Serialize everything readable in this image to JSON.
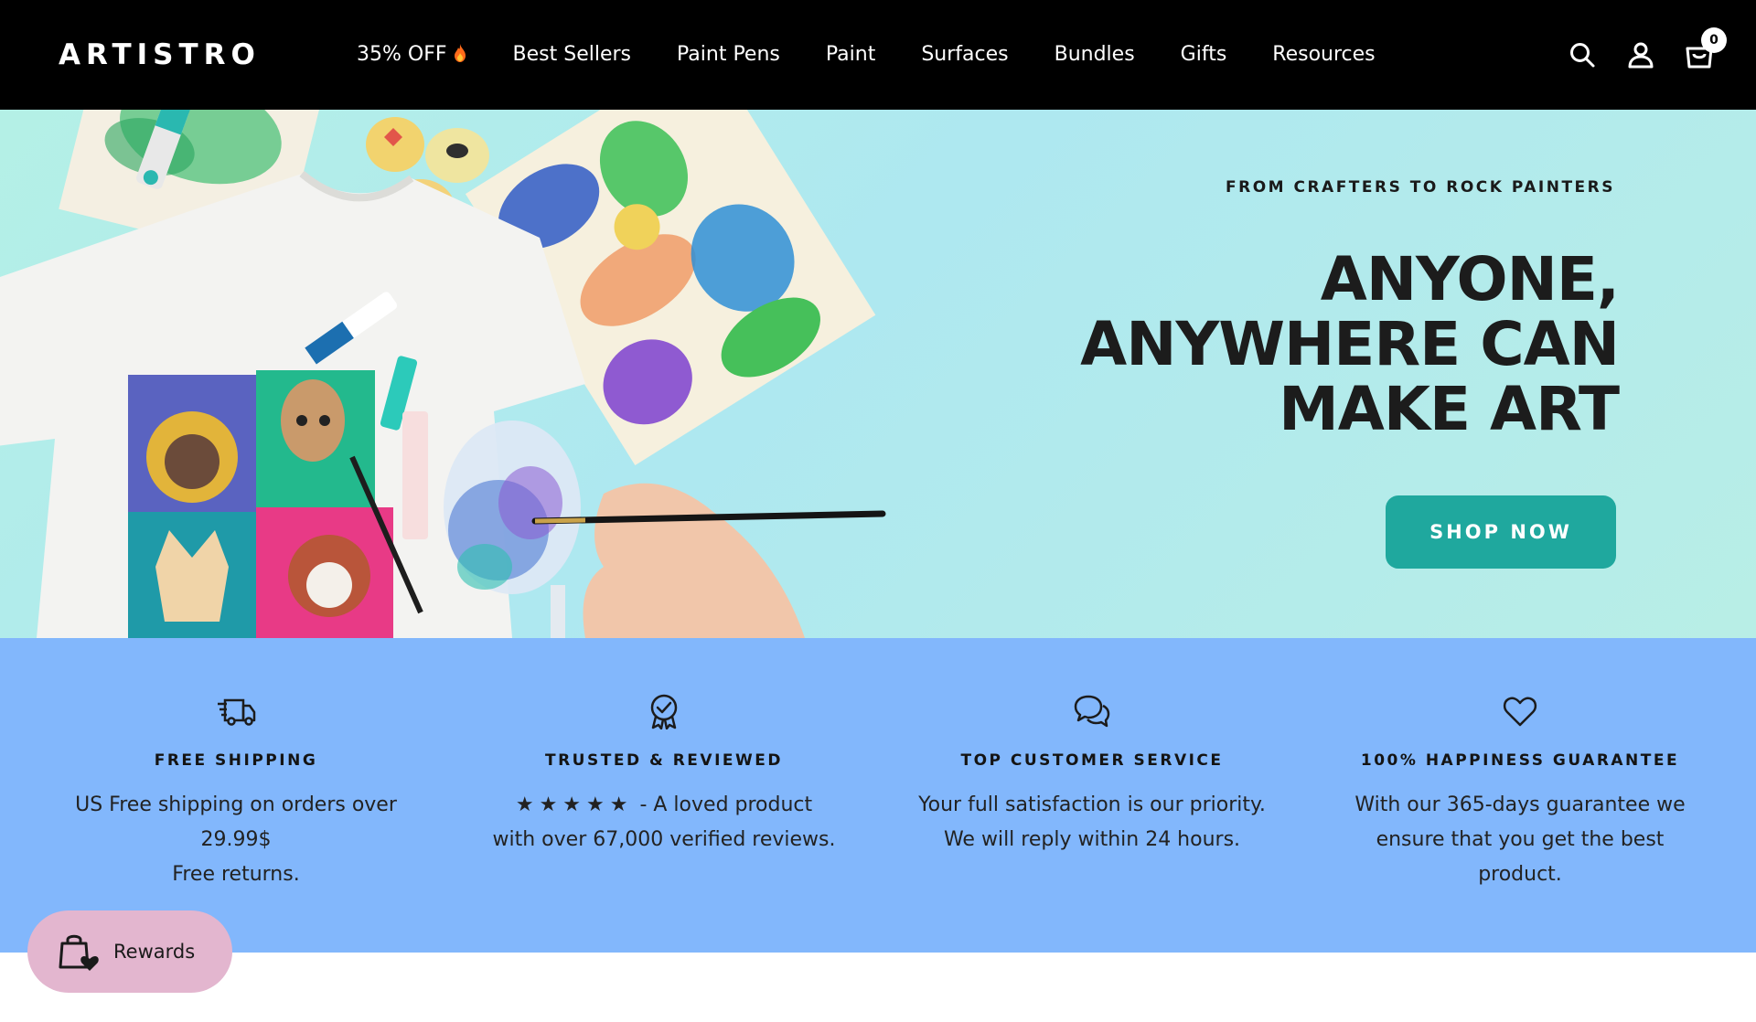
{
  "header": {
    "logo": "ARTISTRO",
    "nav": [
      {
        "label": "35% OFF",
        "icon": "flame-icon"
      },
      {
        "label": "Best Sellers"
      },
      {
        "label": "Paint Pens"
      },
      {
        "label": "Paint"
      },
      {
        "label": "Surfaces"
      },
      {
        "label": "Bundles"
      },
      {
        "label": "Gifts"
      },
      {
        "label": "Resources"
      }
    ],
    "icons": [
      "search-icon",
      "account-icon",
      "cart-icon"
    ],
    "cart_count": "0"
  },
  "hero": {
    "eyebrow": "FROM CRAFTERS TO ROCK PAINTERS",
    "title_lines": [
      "ANYONE,",
      "ANYWHERE CAN",
      "MAKE ART"
    ],
    "cta_label": "SHOP NOW",
    "accent_color": "#1fa89e"
  },
  "features": [
    {
      "icon": "truck-icon",
      "title": "FREE SHIPPING",
      "lines": [
        "US Free shipping on orders over",
        "29.99$",
        "Free returns."
      ]
    },
    {
      "icon": "award-badge-icon",
      "title": "TRUSTED & REVIEWED",
      "stars": "★★★★★",
      "lines": [
        " - A loved product",
        "with over 67,000 verified reviews."
      ]
    },
    {
      "icon": "chat-bubbles-icon",
      "title": "TOP CUSTOMER SERVICE",
      "lines": [
        "Your full satisfaction is our priority.",
        "We will reply within 24 hours."
      ]
    },
    {
      "icon": "heart-icon",
      "title": "100% HAPPINESS GUARANTEE",
      "lines": [
        "With our 365-days guarantee we",
        "ensure that you get the best",
        "product."
      ]
    }
  ],
  "rewards": {
    "label": "Rewards",
    "icon": "shopping-bag-heart-icon"
  }
}
